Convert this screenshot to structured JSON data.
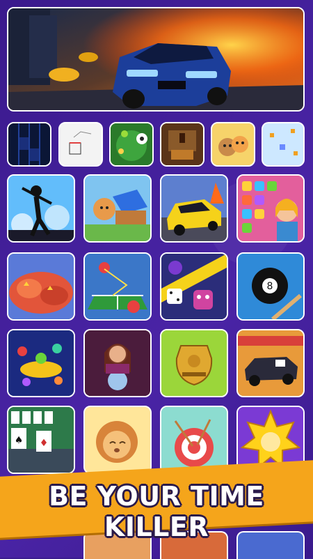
{
  "banner": {
    "title": "BE YOUR TIME KILLER"
  },
  "hero": {
    "name": "racing-car-hero-image"
  },
  "rows": {
    "row0": [
      "piano-tiles",
      "basketball",
      "soccer-pinball",
      "chest-puzzle",
      "puppy-cat",
      "snake-arcade"
    ],
    "row1": [
      "stickman-sniper",
      "hamster-blocks",
      "car-parking",
      "match-3-girl"
    ],
    "row2": [
      "meteor-strike",
      "ping-pong",
      "dice-robots",
      "8-ball-pool"
    ],
    "row3": [
      "monster-island",
      "fortune-teller",
      "golden-urn",
      "demolition-car"
    ],
    "row4": [
      "solitaire",
      "sleeping-lion",
      "darts-target",
      "sun-puzzle"
    ]
  },
  "colors": {
    "background": "#3b1d8f",
    "banner": "#f5a51b",
    "banner_text": "#ffffff"
  }
}
